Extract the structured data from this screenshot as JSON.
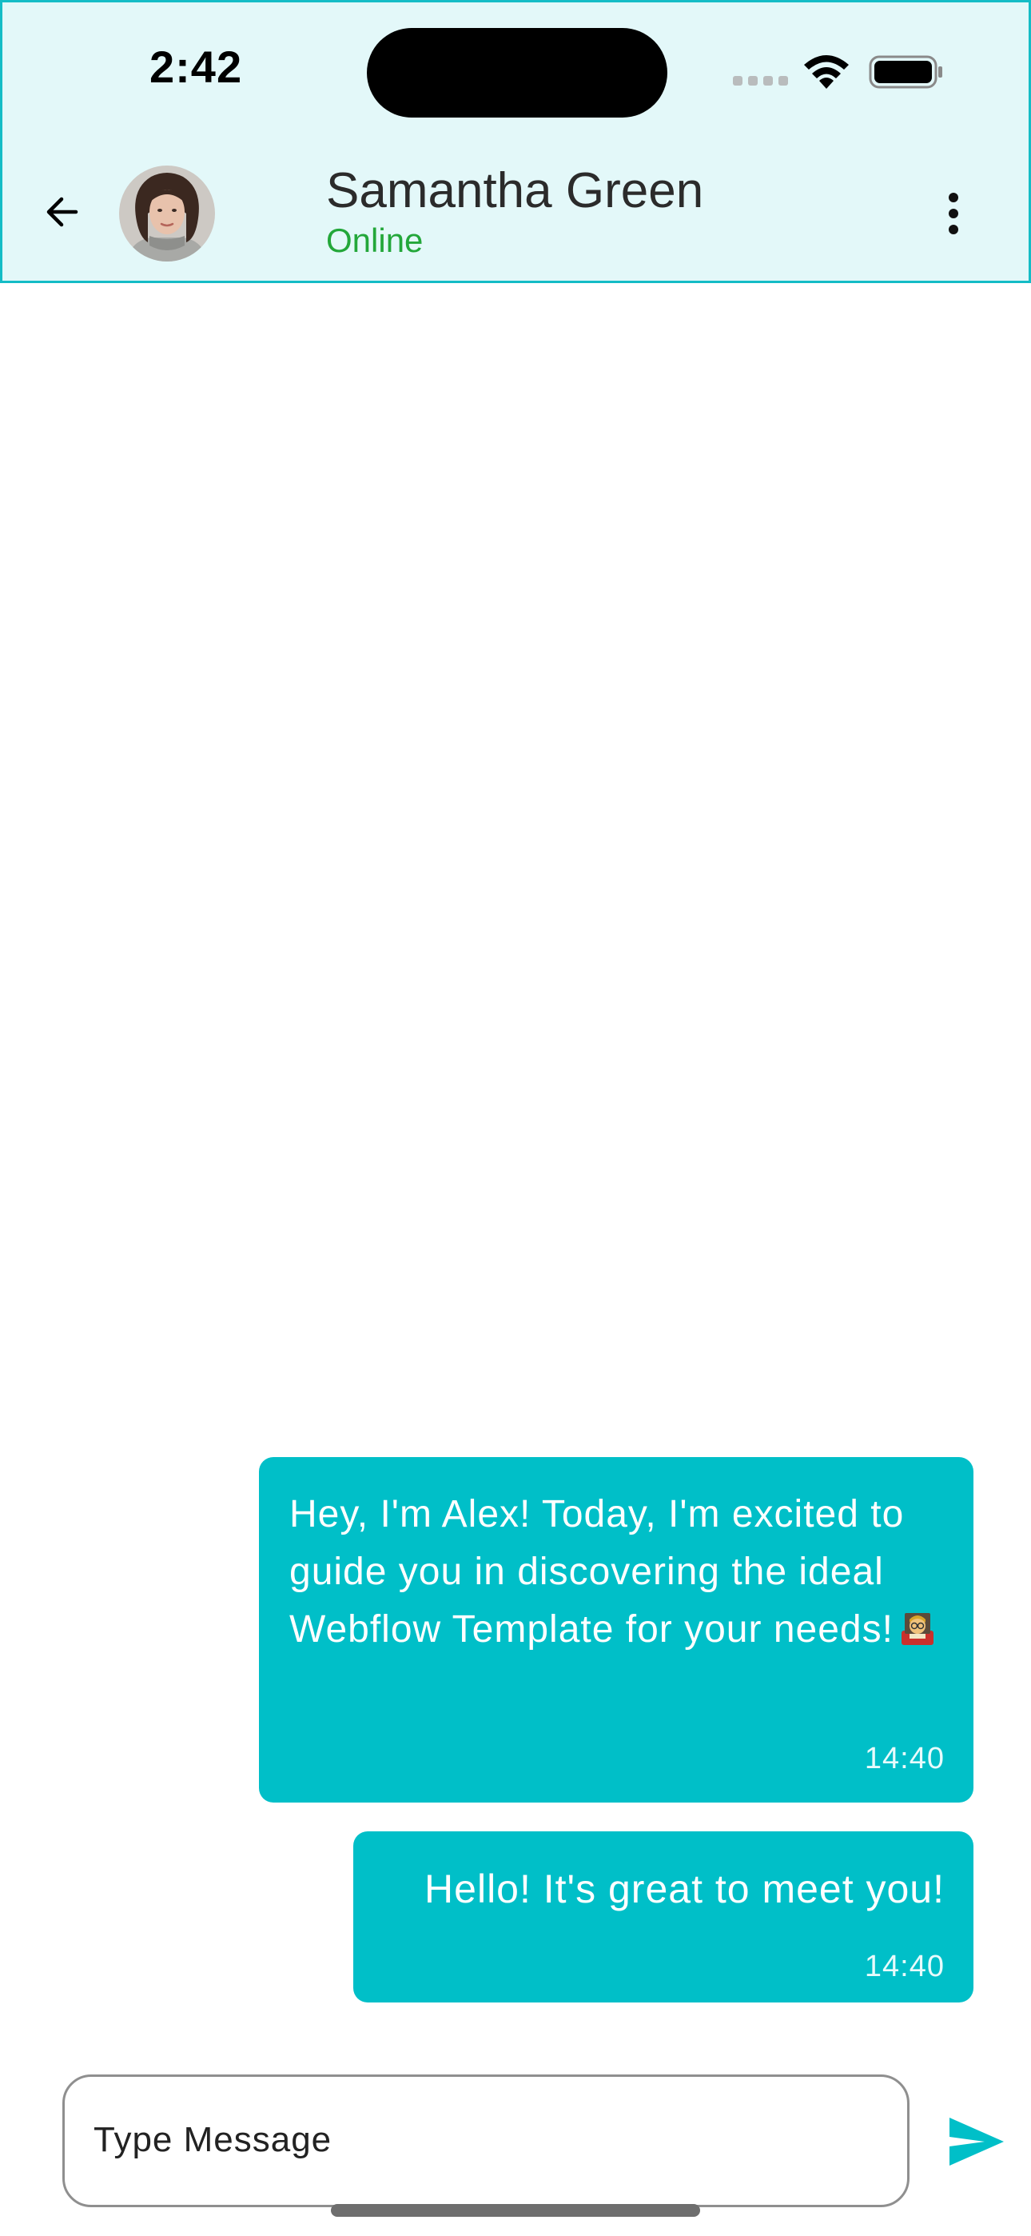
{
  "status_bar": {
    "time": "2:42"
  },
  "header": {
    "contact_name": "Samantha Green",
    "contact_status": "Online"
  },
  "messages": [
    {
      "text": "Hey, I'm Alex! Today, I'm excited to guide you in discovering the ideal Webflow Template for your needs!",
      "emoji": "teacher-emoji",
      "time": "14:40",
      "sender": "self"
    },
    {
      "text": "Hello! It's great to meet you!",
      "time": "14:40",
      "sender": "self"
    }
  ],
  "composer": {
    "placeholder": "Type Message"
  },
  "colors": {
    "header_bg": "#e3f8f9",
    "accent": "#00bfc8",
    "online": "#23a73a"
  },
  "icons": {
    "back": "arrow-left-icon",
    "more": "more-vertical-icon",
    "send": "send-icon",
    "wifi": "wifi-icon",
    "battery": "battery-icon",
    "signal": "cellular-signal-icon"
  }
}
